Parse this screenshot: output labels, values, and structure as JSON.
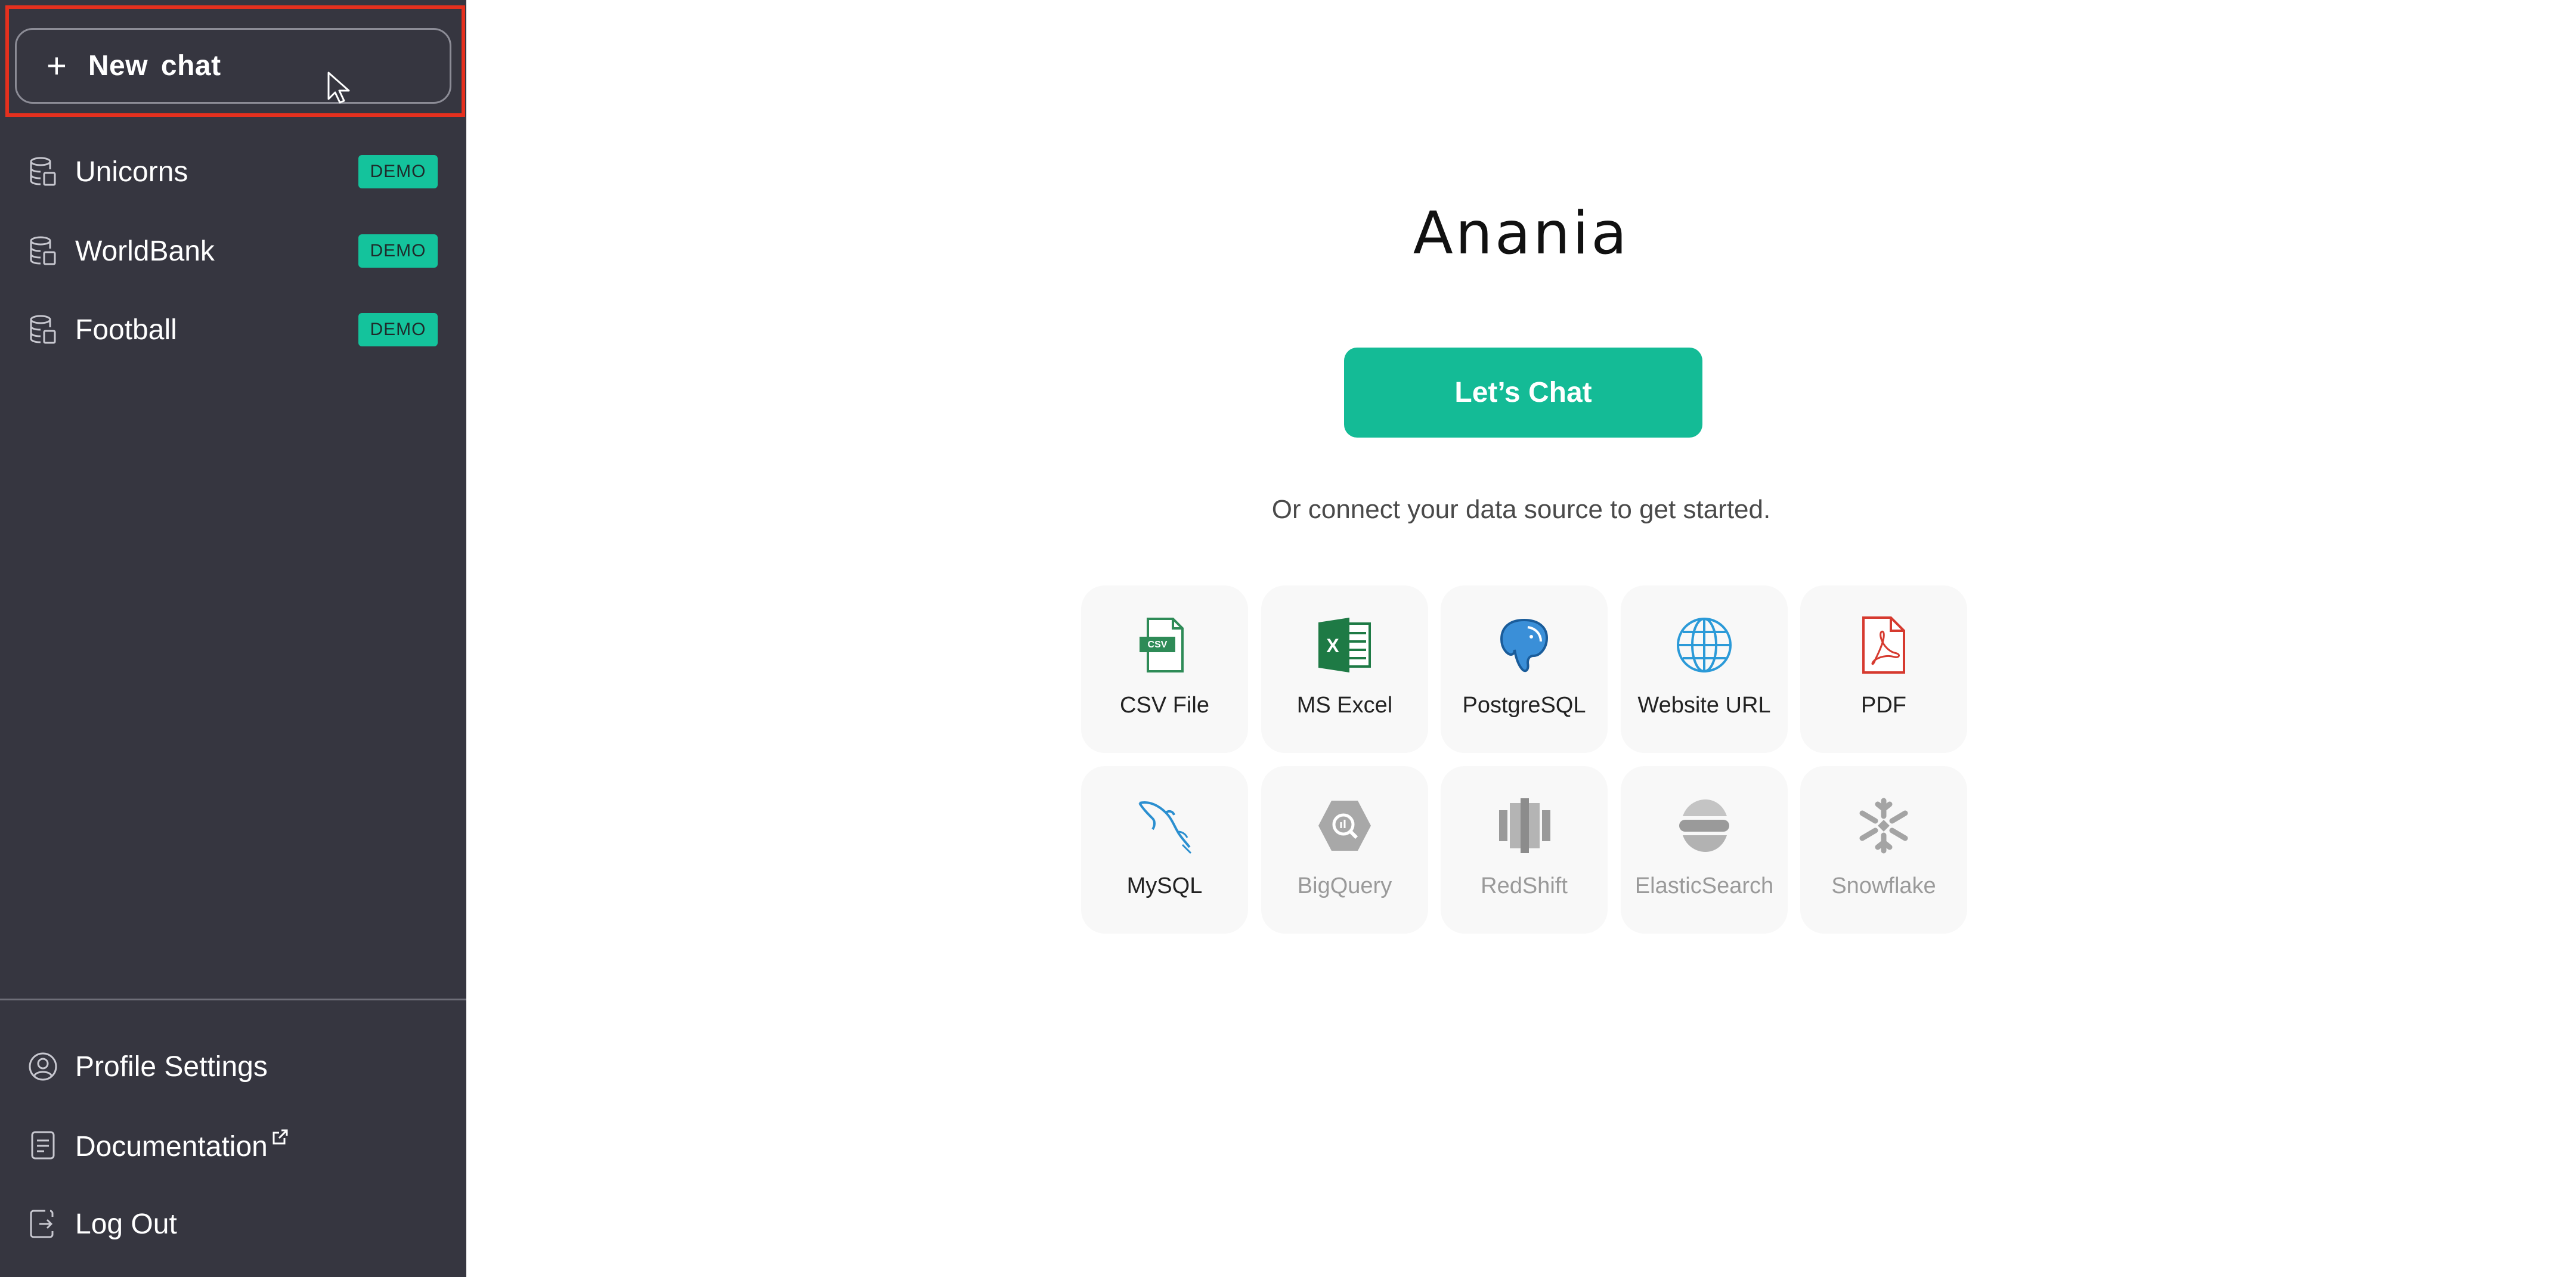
{
  "sidebar": {
    "new_chat_plus": "+",
    "new_chat_label": "New  chat",
    "datasources": [
      {
        "name": "Unicorns",
        "badge": "DEMO"
      },
      {
        "name": "WorldBank",
        "badge": "DEMO"
      },
      {
        "name": "Football",
        "badge": "DEMO"
      }
    ],
    "bottom": {
      "profile": "Profile Settings",
      "documentation": "Documentation",
      "logout": "Log Out"
    }
  },
  "main": {
    "brand": "Anania",
    "cta_label": "Let’s Chat",
    "subtitle": "Or connect your data source to get started.",
    "connectors": [
      {
        "label": "CSV File",
        "icon": "csv-file-icon",
        "csv_tag": "CSV"
      },
      {
        "label": "MS Excel",
        "icon": "excel-icon",
        "excel_tag": "X"
      },
      {
        "label": "PostgreSQL",
        "icon": "postgresql-elephant-icon"
      },
      {
        "label": "Website URL",
        "icon": "globe-icon"
      },
      {
        "label": "PDF",
        "icon": "pdf-icon"
      },
      {
        "label": "MySQL",
        "icon": "mysql-dolphin-icon"
      },
      {
        "label": "BigQuery",
        "icon": "bigquery-icon",
        "disabled": true
      },
      {
        "label": "RedShift",
        "icon": "redshift-icon",
        "disabled": true
      },
      {
        "label": "ElasticSearch",
        "icon": "elasticsearch-icon",
        "disabled": true
      },
      {
        "label": "Snowflake",
        "icon": "snowflake-icon",
        "disabled": true
      }
    ]
  },
  "colors": {
    "sidebar_bg": "#363640",
    "accent": "#14bb96",
    "badge": "#14c39c",
    "highlight": "#e5301e"
  }
}
